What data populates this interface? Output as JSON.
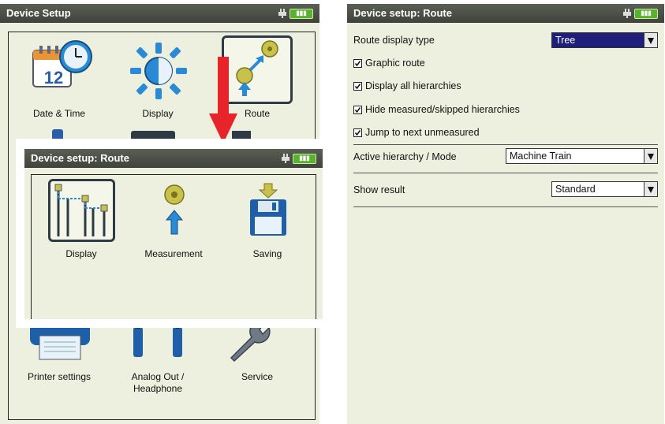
{
  "left_window": {
    "title": "Device Setup",
    "icons": [
      {
        "label": "Date & Time",
        "icon": "calendar-clock-icon",
        "calendar_day": "12"
      },
      {
        "label": "Display",
        "icon": "brightness-icon"
      },
      {
        "label": "Route",
        "icon": "route-icon"
      },
      {
        "label": "Printer settings",
        "icon": "printer-icon"
      },
      {
        "label_line1": "Analog Out /",
        "label_line2": "Headphone",
        "icon": "headphone-icon"
      },
      {
        "label": "Service",
        "icon": "wrench-icon"
      }
    ]
  },
  "overlay_window": {
    "title": "Device setup: Route",
    "icons": [
      {
        "label": "Display",
        "icon": "hierarchy-display-icon",
        "selected": true
      },
      {
        "label": "Measurement",
        "icon": "measurement-icon"
      },
      {
        "label": "Saving",
        "icon": "floppy-save-icon"
      }
    ]
  },
  "right_window": {
    "title": "Device setup: Route",
    "route_display_type_label": "Route display type",
    "route_display_type_value": "Tree",
    "checkboxes": [
      {
        "label": "Graphic route",
        "checked": true
      },
      {
        "label": "Display all hierarchies",
        "checked": true
      },
      {
        "label": "Hide measured/skipped hierarchies",
        "checked": true
      },
      {
        "label": "Jump to next unmeasured",
        "checked": true
      }
    ],
    "active_hierarchy_label": "Active hierarchy / Mode",
    "active_hierarchy_value": "Machine Train",
    "show_result_label": "Show result",
    "show_result_value": "Standard"
  },
  "colors": {
    "titlebar": "#4a4e45",
    "panel_bg": "#eef0df",
    "arrow": "#e8242b",
    "battery": "#58b32c",
    "selected_dropdown": "#1e1f7a"
  }
}
